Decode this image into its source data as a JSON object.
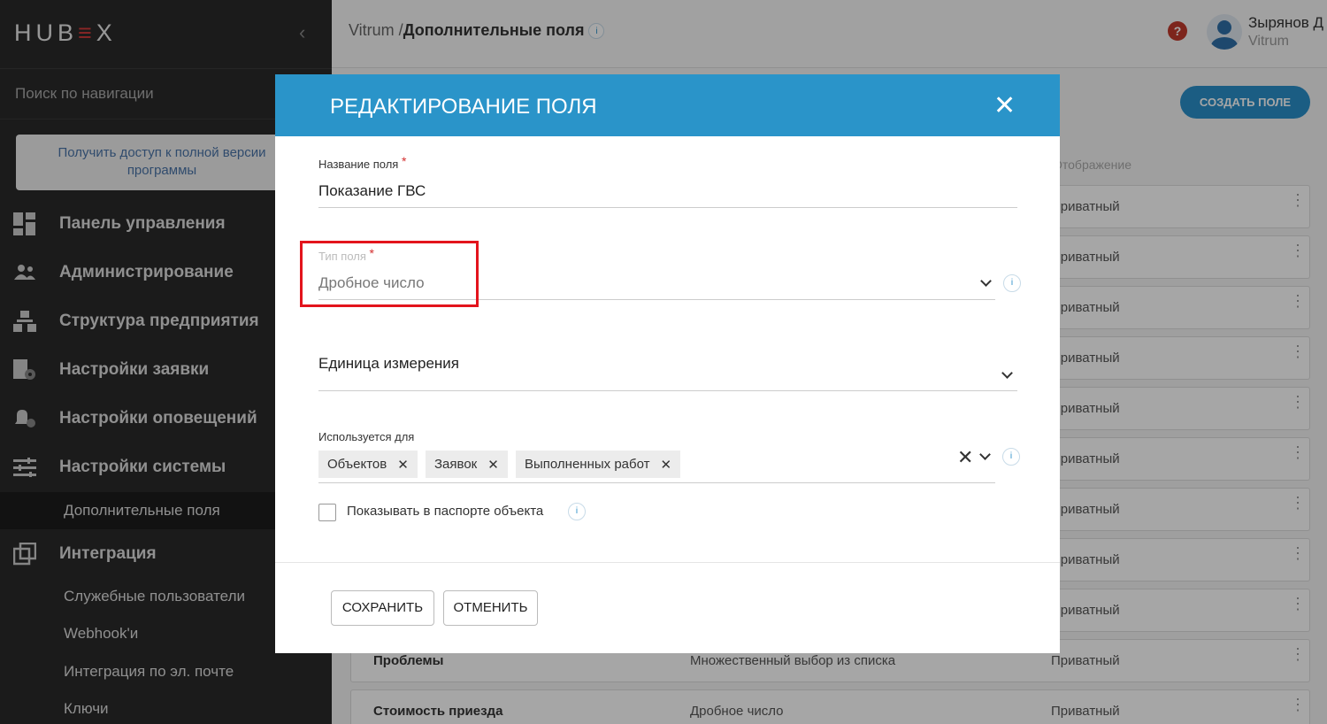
{
  "sidebar": {
    "logo_a": "HUB",
    "logo_b": "≡",
    "logo_c": "X",
    "search_placeholder": "Поиск по навигации",
    "promo": "Получить доступ к полной версии программы",
    "items": [
      {
        "label": "Панель управления",
        "icon": "dashboard-icon"
      },
      {
        "label": "Администрирование",
        "icon": "users-icon"
      },
      {
        "label": "Структура предприятия",
        "icon": "structure-icon"
      },
      {
        "label": "Настройки заявки",
        "icon": "request-settings-icon"
      },
      {
        "label": "Настройки оповещений",
        "icon": "notification-settings-icon"
      },
      {
        "label": "Настройки системы",
        "icon": "system-settings-icon"
      },
      {
        "label": "Интеграция",
        "icon": "integration-icon"
      }
    ],
    "sub_system": "Дополнительные поля",
    "sub_integration": [
      "Служебные пользователи",
      "Webhook'и",
      "Интеграция по эл. почте",
      "Ключи"
    ]
  },
  "header": {
    "breadcrumb_root": "Vitrum /",
    "breadcrumb_current": "Дополнительные поля",
    "user_name": "Зырянов Д",
    "user_org": "Vitrum",
    "create_button": "СОЗДАТЬ ПОЛЕ"
  },
  "table": {
    "col_display": "Отображение",
    "rows": [
      {
        "name": "",
        "type": "",
        "display": "Приватный"
      },
      {
        "name": "",
        "type": "",
        "display": "Приватный"
      },
      {
        "name": "",
        "type": "",
        "display": "Приватный"
      },
      {
        "name": "",
        "type": "",
        "display": "Приватный"
      },
      {
        "name": "",
        "type": "",
        "display": "Приватный"
      },
      {
        "name": "",
        "type": "",
        "display": "Приватный"
      },
      {
        "name": "",
        "type": "",
        "display": "Приватный"
      },
      {
        "name": "",
        "type": "",
        "display": "Приватный"
      },
      {
        "name": "",
        "type": "",
        "display": "Приватный"
      },
      {
        "name": "Проблемы",
        "type": "Множественный выбор из списка",
        "display": "Приватный"
      },
      {
        "name": "Стоимость приезда",
        "type": "Дробное число",
        "display": "Приватный"
      }
    ]
  },
  "modal": {
    "title": "РЕДАКТИРОВАНИЕ ПОЛЯ",
    "field_name_label": "Название поля",
    "field_name_value": "Показание ГВС",
    "field_type_label": "Тип поля",
    "field_type_value": "Дробное число",
    "unit_label": "Единица измерения",
    "used_for_label": "Используется для",
    "used_for_chips": [
      "Объектов",
      "Заявок",
      "Выполненных работ"
    ],
    "show_in_passport_label": "Показывать в паспорте объекта",
    "show_in_passport_checked": false,
    "save_button": "СОХРАНИТЬ",
    "cancel_button": "ОТМЕНИТЬ",
    "required_mark": "*",
    "highlight_color": "#e3141c",
    "accent_color": "#2a94c9"
  }
}
